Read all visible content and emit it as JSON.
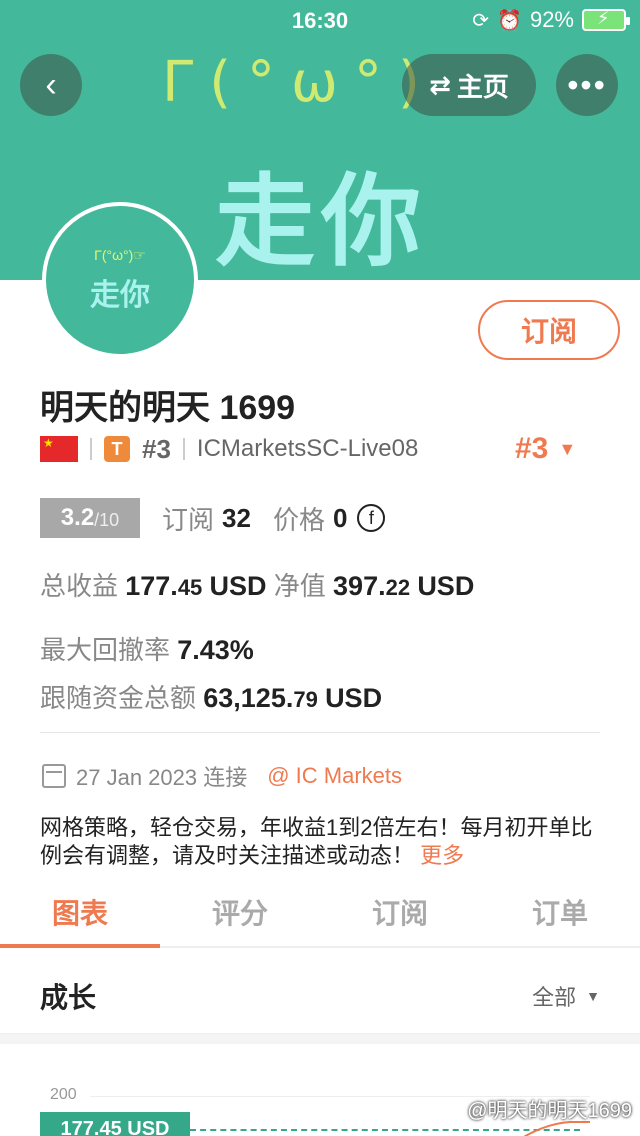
{
  "status_bar": {
    "time": "16:30",
    "battery": "92%"
  },
  "banner": {
    "kaomoji": "Γ(°ω°)",
    "text": "走你"
  },
  "header": {
    "home_label": "主页"
  },
  "avatar": {
    "kaomoji": "Γ(°ω°)☞",
    "text": "走你"
  },
  "profile": {
    "subscribe_label": "订阅",
    "name": "明天的明天 1699",
    "flag": "china-flag",
    "tag": "T",
    "rank_small": "#3",
    "server": "ICMarketsSC-Live08",
    "rank_big": "#3"
  },
  "scores": {
    "rating": "3.2",
    "rating_denominator": "/10",
    "subscriptions_label": "订阅",
    "subscriptions": "32",
    "price_label": "价格",
    "price": "0",
    "price_icon": "f"
  },
  "stats": {
    "total_profit_label": "总收益",
    "total_profit_int": "177.",
    "total_profit_dec": "45",
    "total_profit_unit": "USD",
    "net_value_label": "净值",
    "net_value_int": "397.",
    "net_value_dec": "22",
    "net_value_unit": "USD",
    "max_drawdown_label": "最大回撤率",
    "max_drawdown": "7.43%",
    "follow_total_label": "跟随资金总额",
    "follow_total_int": "63,125.",
    "follow_total_dec": "79",
    "follow_total_unit": "USD"
  },
  "connection": {
    "date": "27 Jan 2023 连接",
    "broker": "@ IC Markets"
  },
  "description": {
    "text": "网格策略，轻仓交易，年收益1到2倍左右！每月初开单比例会有调整，请及时关注描述或动态！",
    "more": "更多"
  },
  "tabs": [
    {
      "label": "图表"
    },
    {
      "label": "评分"
    },
    {
      "label": "订阅"
    },
    {
      "label": "订单"
    }
  ],
  "section": {
    "title": "成长",
    "range": "全部"
  },
  "chart_data": {
    "type": "line",
    "y_tick": "200",
    "current_label": "177.45 USD"
  },
  "watermark": "@明天的明天1699",
  "colors": {
    "banner": "#43b89a",
    "accent": "#f07a50",
    "chart": "#36a88a"
  }
}
